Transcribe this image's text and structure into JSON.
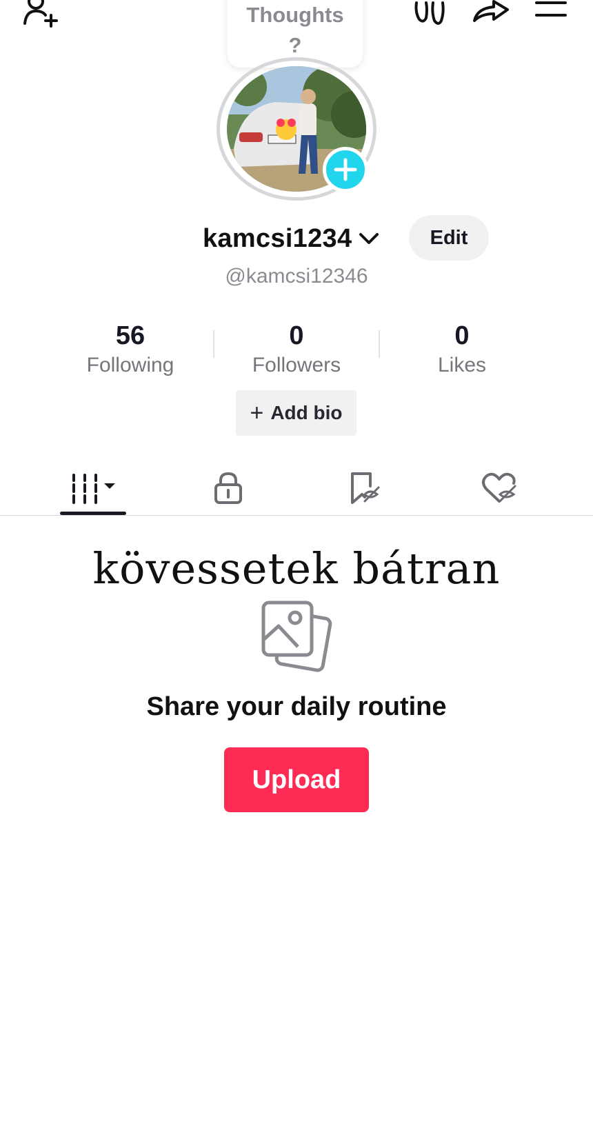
{
  "header": {
    "thoughts_line1": "Thoughts",
    "thoughts_line2": "?",
    "icons": [
      "add-friend-icon",
      "footprints-icon",
      "share-icon",
      "menu-icon"
    ]
  },
  "profile": {
    "username": "kamcsi1234",
    "handle": "@kamcsi12346",
    "edit_label": "Edit",
    "add_bio_label": "Add bio",
    "avatar_badge_color": "#20d5ec"
  },
  "stats": [
    {
      "value": "56",
      "label": "Following"
    },
    {
      "value": "0",
      "label": "Followers"
    },
    {
      "value": "0",
      "label": "Likes"
    }
  ],
  "tabs": [
    {
      "name": "videos",
      "icon": "grid-icon",
      "active": true
    },
    {
      "name": "private",
      "icon": "lock-icon",
      "active": false
    },
    {
      "name": "reposts",
      "icon": "repost-hidden-icon",
      "active": false
    },
    {
      "name": "liked",
      "icon": "heart-hidden-icon",
      "active": false
    }
  ],
  "content": {
    "overlay_text": "kövessetek bátran",
    "empty_title": "Share your daily routine",
    "upload_label": "Upload",
    "accent_color": "#fe2c55"
  }
}
